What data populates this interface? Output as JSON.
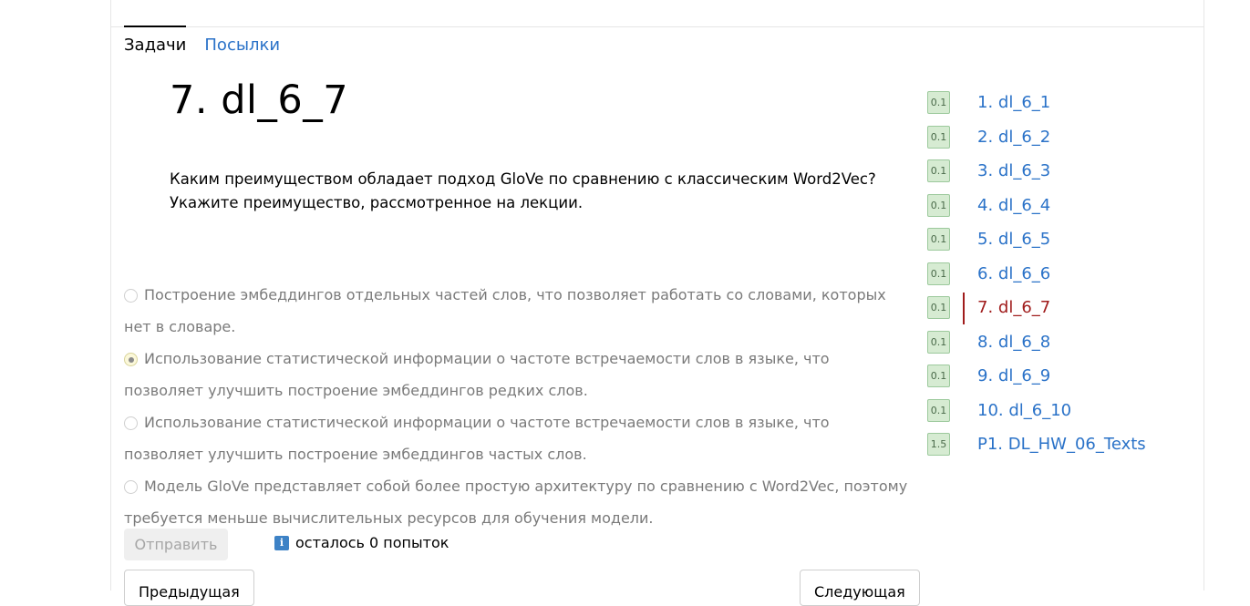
{
  "tabs": {
    "problems": "Задачи",
    "submissions": "Посылки"
  },
  "task": {
    "title": "7. dl_6_7",
    "question_line1": "Каким преимуществом обладает подход GloVe по сравнению с классическим Word2Vec?",
    "question_line2": "Укажите преимущество, рассмотренное на лекции."
  },
  "options": [
    {
      "text": "Построение эмбеддингов отдельных частей слов, что позволяет работать со словами, которых нет в словаре.",
      "selected": false
    },
    {
      "text": "Использование статистической информации о частоте встречаемости слов в языке, что позволяет улучшить построение эмбеддингов редких слов.",
      "selected": true
    },
    {
      "text": "Использование статистической информации о частоте встречаемости слов в языке, что позволяет улучшить построение эмбеддингов частых слов.",
      "selected": false
    },
    {
      "text": "Модель GloVe представляет собой более простую архитектуру по сравнению с Word2Vec, поэтому требуется меньше вычислительных ресурсов для обучения модели.",
      "selected": false
    }
  ],
  "actions": {
    "submit_label": "Отправить",
    "attempts_text": "осталось 0 попыток",
    "info_glyph": "i",
    "prev_label": "Предыдущая",
    "next_label": "Следующая"
  },
  "problems": [
    {
      "score": "0.1",
      "label": "1. dl_6_1",
      "current": false
    },
    {
      "score": "0.1",
      "label": "2. dl_6_2",
      "current": false
    },
    {
      "score": "0.1",
      "label": "3. dl_6_3",
      "current": false
    },
    {
      "score": "0.1",
      "label": "4. dl_6_4",
      "current": false
    },
    {
      "score": "0.1",
      "label": "5. dl_6_5",
      "current": false
    },
    {
      "score": "0.1",
      "label": "6. dl_6_6",
      "current": false
    },
    {
      "score": "0.1",
      "label": "7. dl_6_7",
      "current": true
    },
    {
      "score": "0.1",
      "label": "8. dl_6_8",
      "current": false
    },
    {
      "score": "0.1",
      "label": "9. dl_6_9",
      "current": false
    },
    {
      "score": "0.1",
      "label": "10. dl_6_10",
      "current": false
    },
    {
      "score": "1.5",
      "label": "P1. DL_HW_06_Texts",
      "current": false
    }
  ],
  "colors": {
    "link": "#2a72c8",
    "current": "#a01c1c",
    "badge_bg": "#d6ebd2",
    "badge_border": "#9cc99c"
  }
}
